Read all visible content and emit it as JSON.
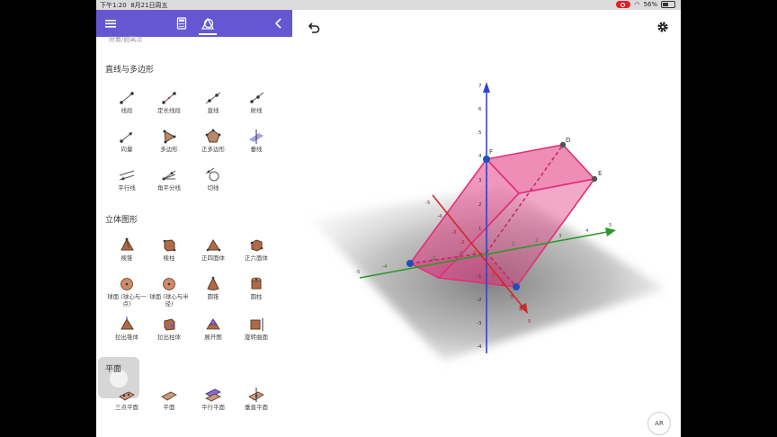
{
  "status": {
    "time": "下午1:20",
    "date": "8月21日周五",
    "battery": "56%"
  },
  "panel": {
    "cut_text": "附着/脱离点",
    "sections": [
      {
        "title": "直线与多边形",
        "tools": [
          "线段",
          "定长线段",
          "直线",
          "射线",
          "向量",
          "多边形",
          "正多边形",
          "垂线",
          "平行线",
          "角平分线",
          "切线"
        ]
      },
      {
        "title": "立体图形",
        "tools": [
          "棱锥",
          "棱柱",
          "正四面体",
          "正六面体",
          "球面 (球心与一点)",
          "球面 (球心与半径)",
          "圆锥",
          "圆柱",
          "拉出锥体",
          "拉出柱体",
          "展开图",
          "旋转曲面"
        ]
      },
      {
        "title": "平面",
        "tools": [
          "三点平面",
          "平面",
          "平行平面",
          "垂直平面"
        ]
      }
    ]
  },
  "view": {
    "points": [
      "D",
      "E",
      "F"
    ],
    "ar_label": "AR",
    "z_ticks": [
      "7",
      "6",
      "5",
      "4",
      "3",
      "2",
      "1",
      "-1",
      "-2",
      "-3",
      "-4"
    ],
    "y_ticks": [
      "-5",
      "-4",
      "-3",
      "-2",
      "-1",
      "1",
      "2",
      "3",
      "4",
      "5"
    ],
    "x_ticks": [
      "-5",
      "-4",
      "-3",
      "-2",
      "-1",
      "1",
      "2",
      "3",
      "4",
      "5"
    ]
  },
  "colors": {
    "toolbar": "#6557d2",
    "solid": "#e0307a",
    "z_axis": "#3344cc",
    "y_axis": "#2a9a2a",
    "x_axis": "#cc2a2a"
  },
  "icons": [
    "menu-icon",
    "calculator-icon",
    "geometry-icon",
    "collapse-icon",
    "undo-icon",
    "settings-icon"
  ]
}
